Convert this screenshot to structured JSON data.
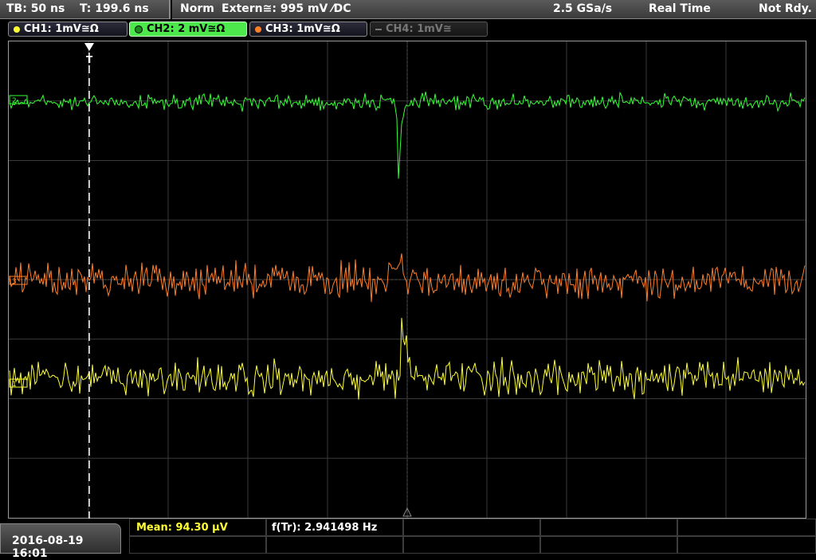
{
  "header": {
    "timebase": "TB: 50 ns",
    "trigger_time": "T: 199.6 ns",
    "mode": "Norm",
    "trigger_source": "Extern≅: 995 mV ⁄DC",
    "sample_rate": "2.5 GSa/s",
    "acquisition": "Real Time",
    "status": "Not Rdy."
  },
  "channels": [
    {
      "label": "CH1: 1mV≅Ω",
      "color": "#ffff33",
      "state": "on"
    },
    {
      "label": "CH2: 2 mV≅Ω",
      "color": "#33ff33",
      "state": "selected"
    },
    {
      "label": "CH3: 1mV≅Ω",
      "color": "#ff7f27",
      "state": "on"
    },
    {
      "label": "CH4: 1mV≅",
      "color": "#777777",
      "state": "off"
    }
  ],
  "waveform_markers": {
    "trigger_marker": "T",
    "ch2_marker": "2",
    "ch3_marker": "3",
    "ch1_marker": "1"
  },
  "footer": {
    "datetime": "2016-08-19 16:01",
    "measurement_1": "Mean: 94.30 µV",
    "measurement_2": "f(Tr): 2.941498 Hz"
  },
  "colors": {
    "grid": "#3a3a3a",
    "ch1": "#ffff33",
    "ch2": "#33ff33",
    "ch3": "#ff7f27",
    "mean_text": "#ffff33"
  }
}
